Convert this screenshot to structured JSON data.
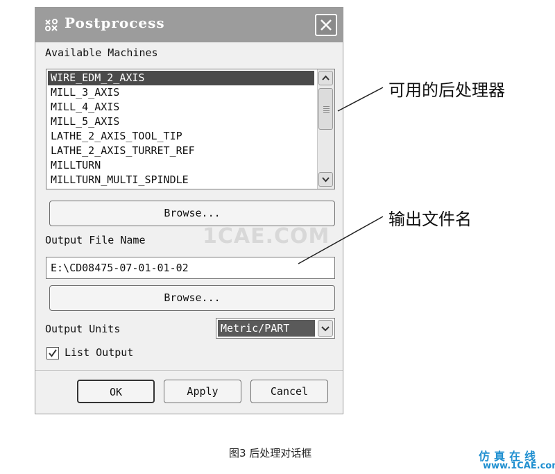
{
  "dialog": {
    "title": "Postprocess",
    "available_machines_label": "Available Machines",
    "machines": [
      "WIRE_EDM_2_AXIS",
      "MILL_3_AXIS",
      "MILL_4_AXIS",
      "MILL_5_AXIS",
      "LATHE_2_AXIS_TOOL_TIP",
      "LATHE_2_AXIS_TURRET_REF",
      "MILLTURN",
      "MILLTURN_MULTI_SPINDLE"
    ],
    "selected_machine": "WIRE_EDM_2_AXIS",
    "browse_machines_label": "Browse...",
    "output_file_name_label": "Output File Name",
    "output_file_value": "E:\\CD08475-07-01-01-02",
    "browse_file_label": "Browse...",
    "output_units_label": "Output Units",
    "output_units_value": "Metric/PART",
    "list_output_label": "List Output",
    "list_output_checked": true,
    "ok_label": "OK",
    "apply_label": "Apply",
    "cancel_label": "Cancel"
  },
  "annotations": {
    "machines_note": "可用的后处理器",
    "output_note": "输出文件名"
  },
  "caption": "图3 后处理对话框",
  "watermark": "1CAE.COM",
  "logo": {
    "text": "仿真在线",
    "url": "www.1CAE.com",
    "color": "#1f8fd0"
  },
  "icons": [
    "app-icon",
    "close-icon",
    "scroll-up-icon",
    "scroll-down-icon",
    "dropdown-arrow-icon",
    "checkmark-icon"
  ]
}
